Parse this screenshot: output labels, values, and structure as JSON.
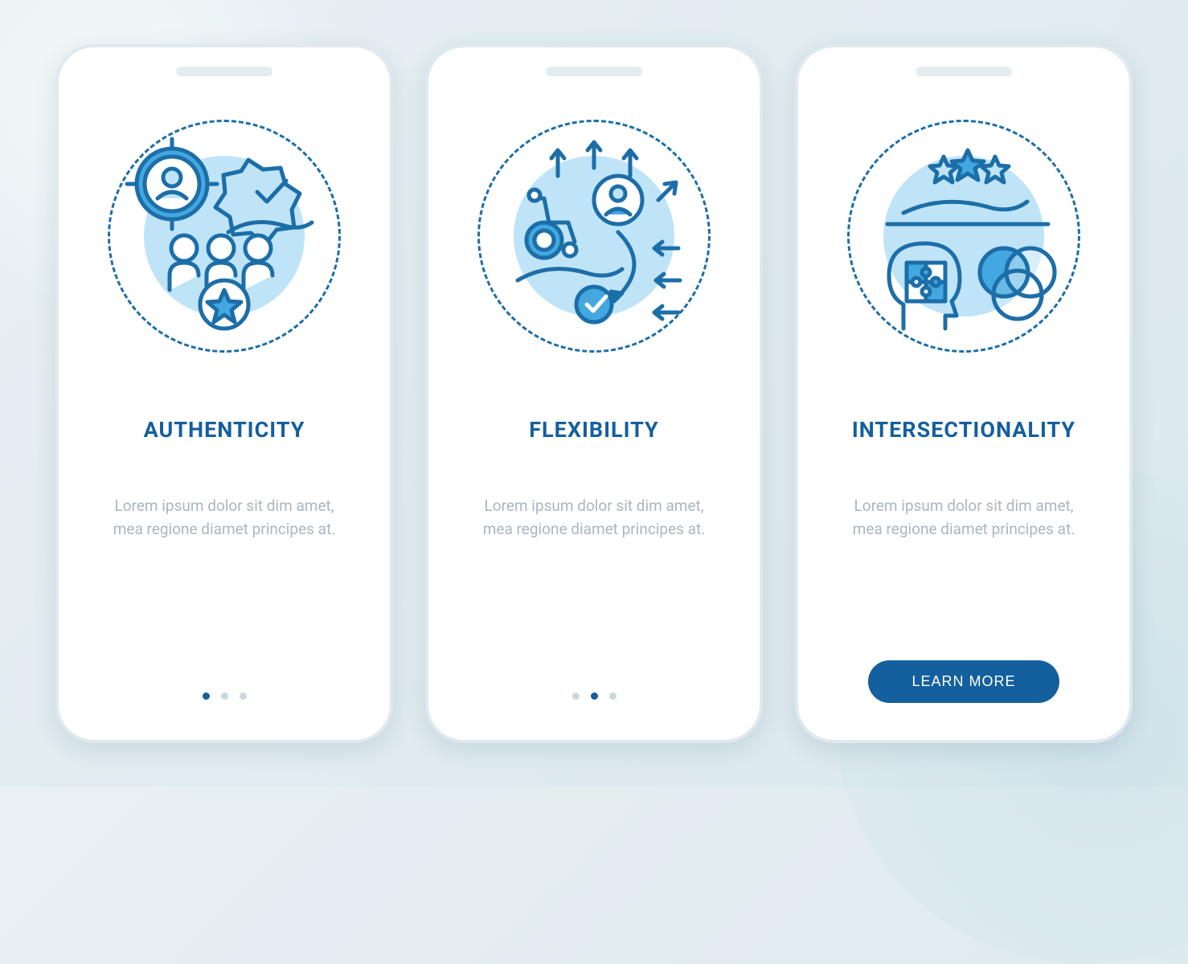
{
  "screens": [
    {
      "title": "AUTHENTICITY",
      "body": "Lorem ipsum dolor sit dim amet, mea regione diamet principes at.",
      "page_index": 0,
      "page_count": 3,
      "icon": "authenticity-icon"
    },
    {
      "title": "FLEXIBILITY",
      "body": "Lorem ipsum dolor sit dim amet, mea regione diamet principes at.",
      "page_index": 1,
      "page_count": 3,
      "icon": "flexibility-icon"
    },
    {
      "title": "INTERSECTIONALITY",
      "body": "Lorem ipsum dolor sit dim amet, mea regione diamet principes at.",
      "cta_label": "LEARN MORE",
      "icon": "intersectionality-icon"
    }
  ],
  "colors": {
    "primary": "#145f9e",
    "accent_light": "#bfe4f7",
    "stroke": "#1c6ea8",
    "muted": "#aab6c0"
  }
}
